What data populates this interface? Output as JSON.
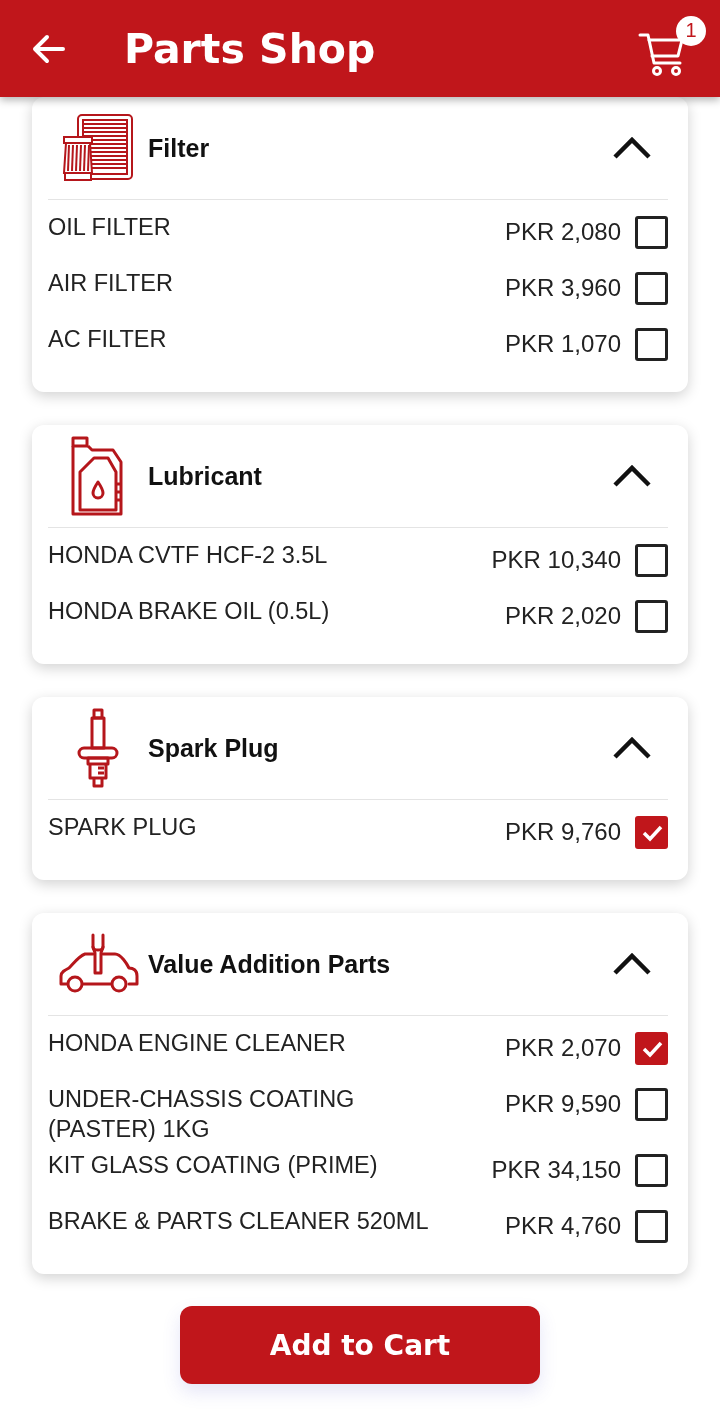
{
  "header": {
    "title": "Parts Shop",
    "cart_count": "1"
  },
  "categories": [
    {
      "kind": "filter",
      "title": "Filter",
      "expanded": true,
      "items": [
        {
          "name": "OIL FILTER",
          "price": "PKR 2,080",
          "checked": false
        },
        {
          "name": "AIR FILTER",
          "price": "PKR 3,960",
          "checked": false
        },
        {
          "name": "AC FILTER",
          "price": "PKR 1,070",
          "checked": false
        }
      ]
    },
    {
      "kind": "lubricant",
      "title": "Lubricant",
      "expanded": true,
      "items": [
        {
          "name": "HONDA CVTF HCF-2 3.5L",
          "price": "PKR 10,340",
          "checked": false
        },
        {
          "name": "HONDA BRAKE OIL (0.5L)",
          "price": "PKR 2,020",
          "checked": false
        }
      ]
    },
    {
      "kind": "spark",
      "title": "Spark Plug",
      "expanded": true,
      "items": [
        {
          "name": "SPARK PLUG",
          "price": "PKR 9,760",
          "checked": true
        }
      ]
    },
    {
      "kind": "value",
      "title": "Value Addition Parts",
      "expanded": true,
      "items": [
        {
          "name": "HONDA ENGINE CLEANER",
          "price": "PKR 2,070",
          "checked": true
        },
        {
          "name": "UNDER-CHASSIS COATING (PASTER) 1KG",
          "price": "PKR 9,590",
          "checked": false
        },
        {
          "name": "KIT GLASS COATING (PRIME)",
          "price": "PKR 34,150",
          "checked": false
        },
        {
          "name": "BRAKE & PARTS CLEANER 520ML",
          "price": "PKR 4,760",
          "checked": false
        }
      ]
    }
  ],
  "action": {
    "label": "Add to Cart"
  }
}
